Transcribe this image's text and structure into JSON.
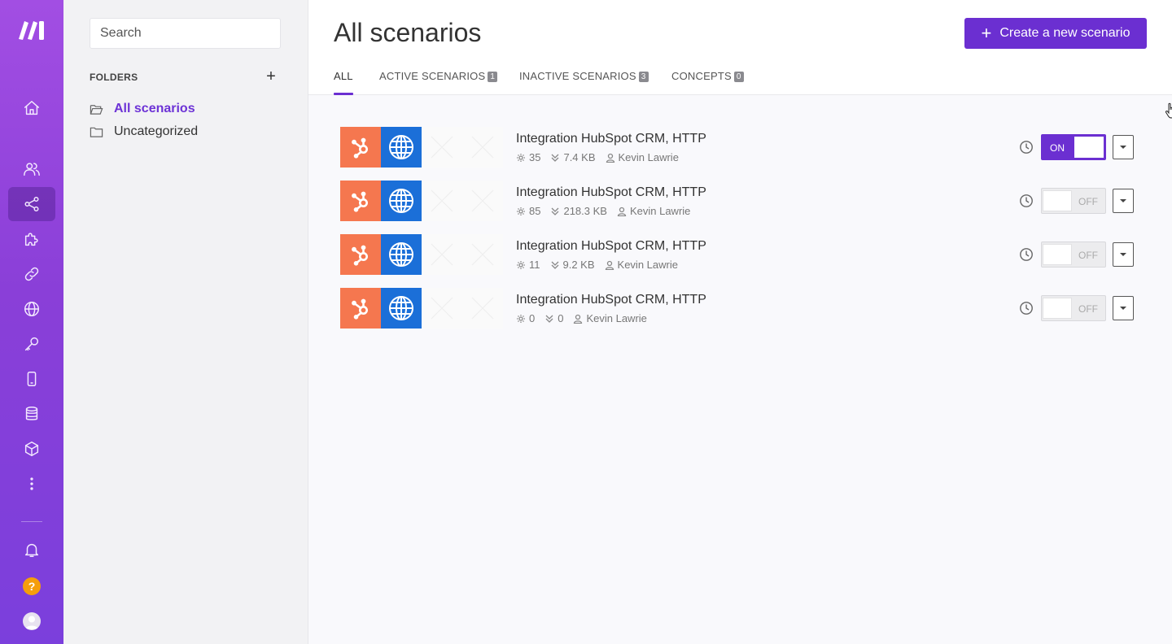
{
  "sidebar_rail": {
    "items": [
      {
        "name": "home-icon",
        "active": false
      },
      {
        "name": "team-icon",
        "active": false
      },
      {
        "name": "scenarios-share-icon",
        "active": true
      },
      {
        "name": "puzzle-icon",
        "active": false
      },
      {
        "name": "link-icon",
        "active": false
      },
      {
        "name": "globe-icon",
        "active": false
      },
      {
        "name": "key-icon",
        "active": false
      },
      {
        "name": "device-icon",
        "active": false
      },
      {
        "name": "database-icon",
        "active": false
      },
      {
        "name": "cube-icon",
        "active": false
      },
      {
        "name": "more-icon",
        "active": false
      }
    ],
    "help_label": "?"
  },
  "folders": {
    "search_placeholder": "Search",
    "heading": "FOLDERS",
    "add_label": "+",
    "items": [
      {
        "label": "All scenarios",
        "active": true
      },
      {
        "label": "Uncategorized",
        "active": false
      }
    ]
  },
  "main": {
    "title": "All scenarios",
    "create_button": "Create a new scenario",
    "create_plus": "+",
    "tabs": [
      {
        "label": "ALL",
        "count": null,
        "active": true
      },
      {
        "label": "ACTIVE SCENARIOS",
        "count": "1",
        "active": false
      },
      {
        "label": "INACTIVE SCENARIOS",
        "count": "3",
        "active": false
      },
      {
        "label": "CONCEPTS",
        "count": "0",
        "active": false
      }
    ]
  },
  "scenarios": [
    {
      "title": "Integration HubSpot CRM, HTTP",
      "operations": "35",
      "data": "7.4 KB",
      "owner": "Kevin Lawrie",
      "toggle": "ON",
      "enabled": true
    },
    {
      "title": "Integration HubSpot CRM, HTTP",
      "operations": "85",
      "data": "218.3 KB",
      "owner": "Kevin Lawrie",
      "toggle": "OFF",
      "enabled": false
    },
    {
      "title": "Integration HubSpot CRM, HTTP",
      "operations": "11",
      "data": "9.2 KB",
      "owner": "Kevin Lawrie",
      "toggle": "OFF",
      "enabled": false
    },
    {
      "title": "Integration HubSpot CRM, HTTP",
      "operations": "0",
      "data": "0",
      "owner": "Kevin Lawrie",
      "toggle": "OFF",
      "enabled": false
    }
  ],
  "colors": {
    "brand": "#6b2fd1",
    "hubspot": "#f5774f",
    "http": "#1b6fd8",
    "help": "#f59e0b"
  }
}
